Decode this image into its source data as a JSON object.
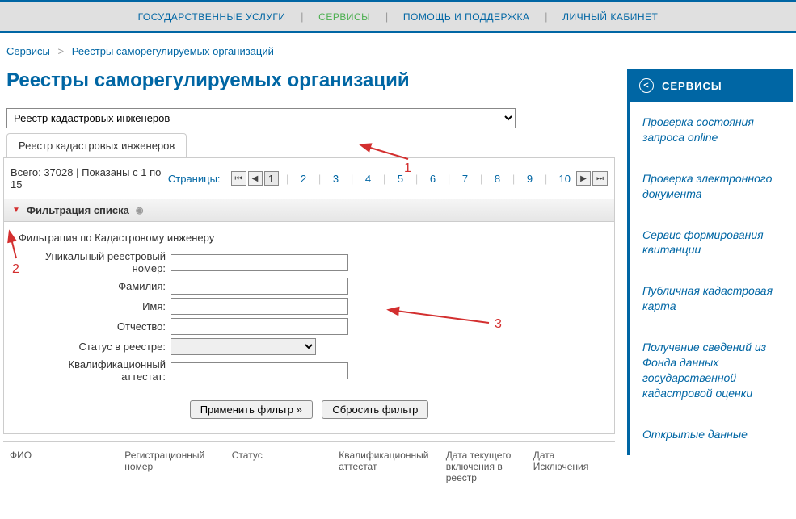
{
  "nav": {
    "items": [
      {
        "label": "ГОСУДАРСТВЕННЫЕ УСЛУГИ",
        "active": false
      },
      {
        "label": "СЕРВИСЫ",
        "active": true
      },
      {
        "label": "ПОМОЩЬ И ПОДДЕРЖКА",
        "active": false
      },
      {
        "label": "ЛИЧНЫЙ КАБИНЕТ",
        "active": false
      }
    ]
  },
  "breadcrumb": {
    "root": "Сервисы",
    "current": "Реестры саморегулируемых организаций"
  },
  "page_title": "Реестры саморегулируемых организаций",
  "registry_select": {
    "value": "Реестр кадастровых инженеров"
  },
  "tab": {
    "label": "Реестр кадастровых инженеров"
  },
  "records": {
    "total_label": "Всего:",
    "total_value": "37028",
    "shown_label": "Показаны с",
    "shown_from": "1",
    "shown_to_label": "по",
    "shown_to": "15"
  },
  "pagination": {
    "label": "Страницы:",
    "pages": [
      "1",
      "2",
      "3",
      "4",
      "5",
      "6",
      "7",
      "8",
      "9",
      "10"
    ],
    "active_page": "1"
  },
  "filter": {
    "header": "Фильтрация списка",
    "section_title": "Фильтрация по Кадастровому инженеру",
    "fields": {
      "reg_no": "Уникальный реестровый номер:",
      "surname": "Фамилия:",
      "name": "Имя:",
      "patronymic": "Отчество:",
      "status": "Статус в реестре:",
      "cert": "Квалификационный аттестат:"
    },
    "apply_btn": "Применить фильтр »",
    "reset_btn": "Сбросить фильтр"
  },
  "table_headers": {
    "fio": "ФИО",
    "reg_no": "Регистрационный номер",
    "status": "Статус",
    "cert": "Квалификационный аттестат",
    "date_inc": "Дата текущего включения в реестр",
    "date_exc": "Дата Исключения"
  },
  "sidebar": {
    "title": "СЕРВИСЫ",
    "items": [
      "Проверка состояния запроса online",
      "Проверка электронного документа",
      "Сервис формирования квитанции",
      "Публичная кадастровая карта",
      "Получение сведений из Фонда данных государственной кадастровой оценки",
      "Открытые данные"
    ]
  },
  "annotations": {
    "a1": "1",
    "a2": "2",
    "a3": "3"
  }
}
